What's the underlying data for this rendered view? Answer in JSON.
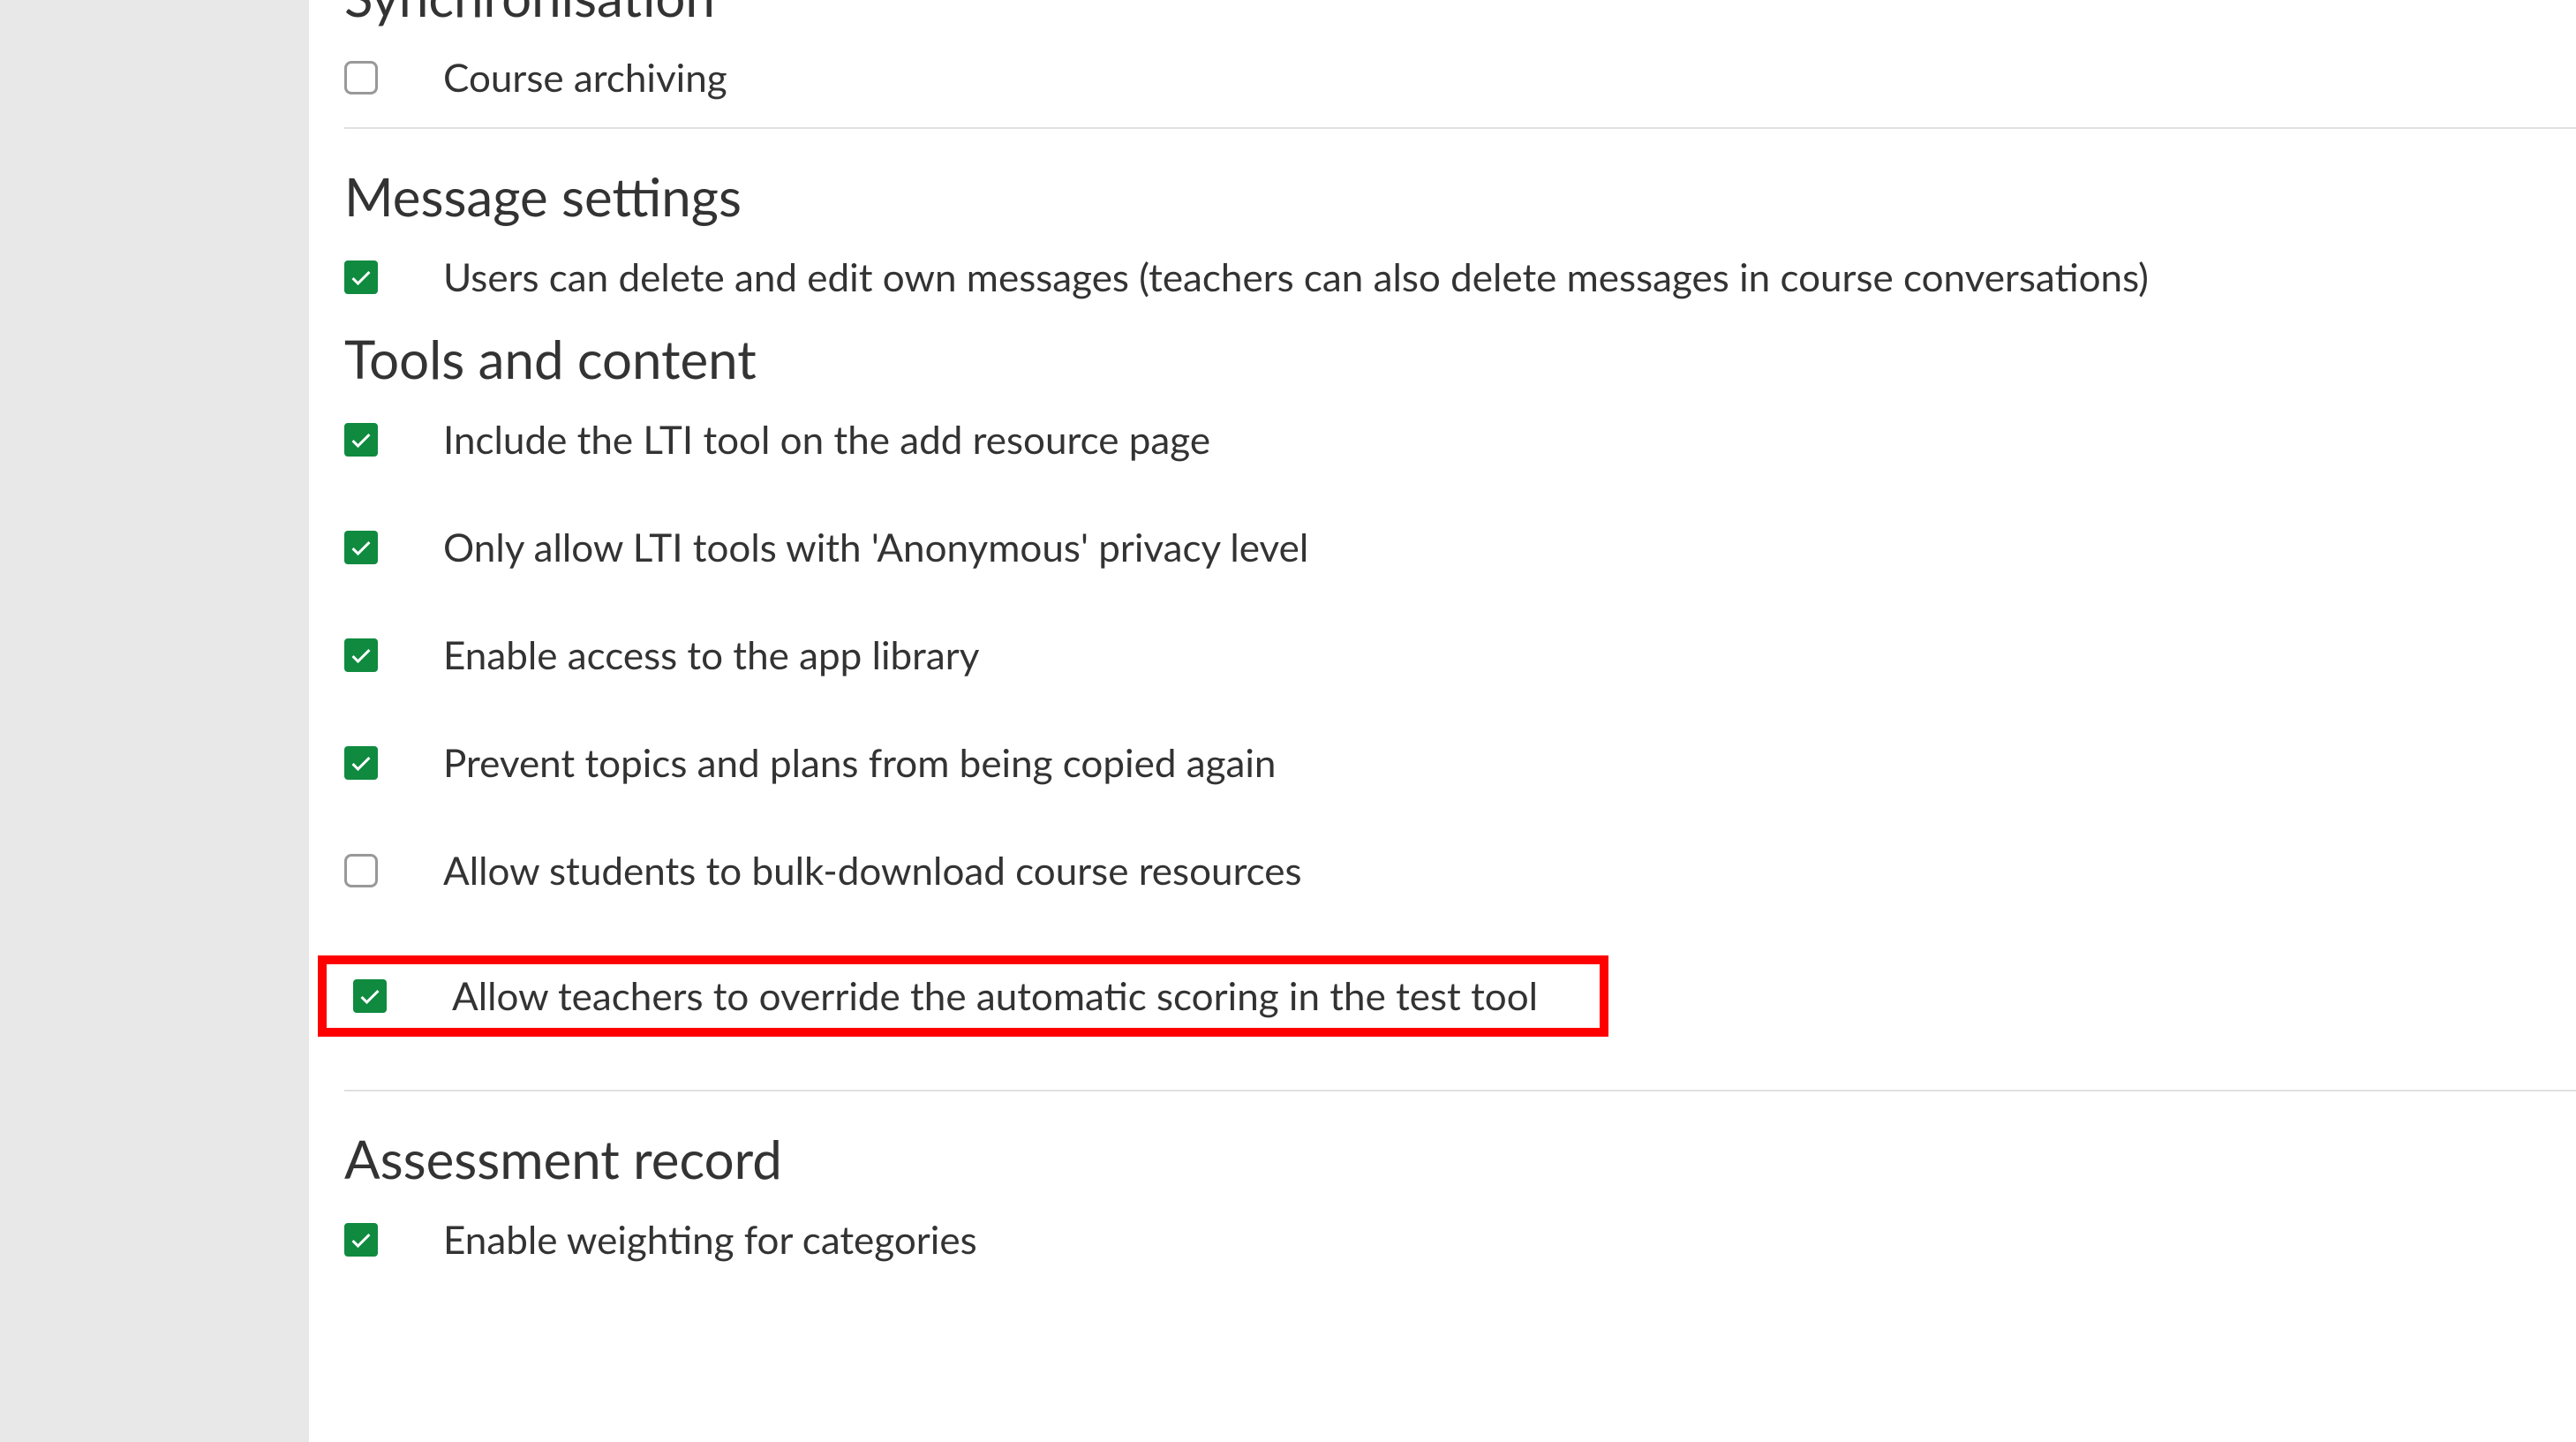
{
  "sections": {
    "synchronisation": {
      "title": "Synchronisation",
      "options": {
        "course_archiving": {
          "label": "Course archiving",
          "checked": false
        }
      }
    },
    "message_settings": {
      "title": "Message settings",
      "options": {
        "users_edit_messages": {
          "label": "Users can delete and edit own messages (teachers can also delete messages in course conversations)",
          "checked": true
        }
      }
    },
    "tools_and_content": {
      "title": "Tools and content",
      "options": {
        "include_lti_tool": {
          "label": "Include the LTI tool on the add resource page",
          "checked": true
        },
        "only_anonymous_lti": {
          "label": "Only allow LTI tools with 'Anonymous' privacy level",
          "checked": true
        },
        "enable_app_library": {
          "label": "Enable access to the app library",
          "checked": true
        },
        "prevent_copy": {
          "label": "Prevent topics and plans from being copied again",
          "checked": true
        },
        "bulk_download": {
          "label": "Allow students to bulk-download course resources",
          "checked": false
        },
        "override_scoring": {
          "label": "Allow teachers to override the automatic scoring in the test tool",
          "checked": true,
          "highlighted": true
        }
      }
    },
    "assessment_record": {
      "title": "Assessment record",
      "options": {
        "enable_weighting": {
          "label": "Enable weighting for categories",
          "checked": true
        }
      }
    }
  },
  "colors": {
    "checkbox_checked": "#0f8a3f",
    "highlight_border": "#ff0000"
  }
}
